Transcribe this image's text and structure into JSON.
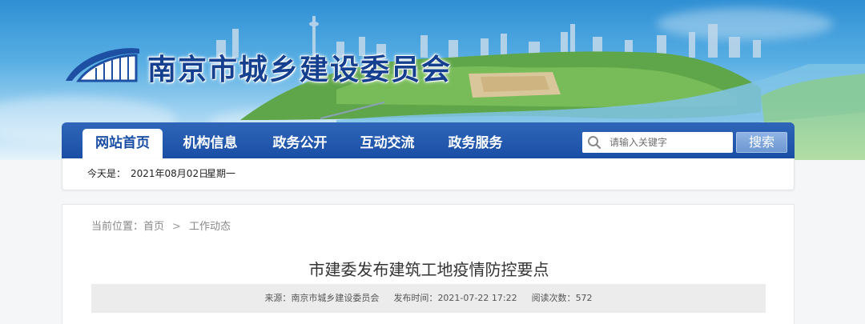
{
  "header": {
    "site_title": "南京市城乡建设委员会"
  },
  "nav": {
    "items": [
      {
        "label": "网站首页",
        "active": true
      },
      {
        "label": "机构信息",
        "active": false
      },
      {
        "label": "政务公开",
        "active": false
      },
      {
        "label": "互动交流",
        "active": false
      },
      {
        "label": "政务服务",
        "active": false
      }
    ],
    "search": {
      "placeholder": "请输入关键字",
      "button_label": "搜索",
      "icon": "search-icon"
    }
  },
  "datebar": {
    "prefix": "今天是：",
    "date": "2021年08月02日",
    "weekday": "星期一"
  },
  "breadcrumb": {
    "prefix": "当前位置：",
    "items": [
      "首页",
      "工作动态"
    ],
    "separator": ">"
  },
  "article": {
    "title": "市建委发布建筑工地疫情防控要点",
    "source_label": "来源：",
    "source": "南京市城乡建设委员会",
    "published_label": "发布时间：",
    "published": "2021-07-22 17:22",
    "views_label": "阅读次数：",
    "views": "572"
  },
  "colors": {
    "nav_blue": "#1a4ea5",
    "title_blue": "#153f8f",
    "sky": "#57aee3"
  }
}
